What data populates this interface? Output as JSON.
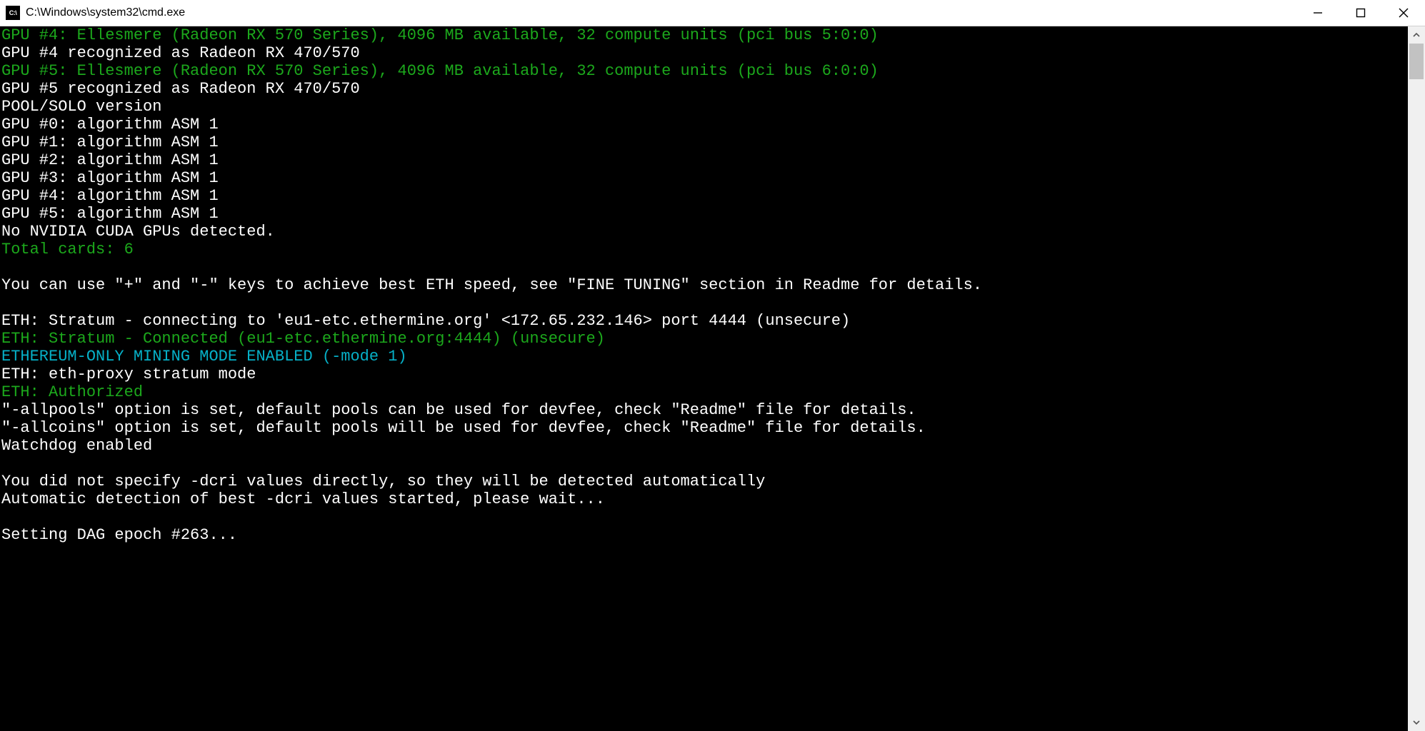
{
  "window": {
    "title": "C:\\Windows\\system32\\cmd.exe",
    "icon_label": "C:\\"
  },
  "lines": [
    {
      "cls": "g",
      "text": "GPU #4: Ellesmere (Radeon RX 570 Series), 4096 MB available, 32 compute units (pci bus 5:0:0)"
    },
    {
      "cls": "",
      "text": "GPU #4 recognized as Radeon RX 470/570"
    },
    {
      "cls": "g",
      "text": "GPU #5: Ellesmere (Radeon RX 570 Series), 4096 MB available, 32 compute units (pci bus 6:0:0)"
    },
    {
      "cls": "",
      "text": "GPU #5 recognized as Radeon RX 470/570"
    },
    {
      "cls": "",
      "text": "POOL/SOLO version"
    },
    {
      "cls": "",
      "text": "GPU #0: algorithm ASM 1"
    },
    {
      "cls": "",
      "text": "GPU #1: algorithm ASM 1"
    },
    {
      "cls": "",
      "text": "GPU #2: algorithm ASM 1"
    },
    {
      "cls": "",
      "text": "GPU #3: algorithm ASM 1"
    },
    {
      "cls": "",
      "text": "GPU #4: algorithm ASM 1"
    },
    {
      "cls": "",
      "text": "GPU #5: algorithm ASM 1"
    },
    {
      "cls": "",
      "text": "No NVIDIA CUDA GPUs detected."
    },
    {
      "cls": "g",
      "text": "Total cards: 6"
    },
    {
      "cls": "",
      "text": ""
    },
    {
      "cls": "",
      "text": "You can use \"+\" and \"-\" keys to achieve best ETH speed, see \"FINE TUNING\" section in Readme for details."
    },
    {
      "cls": "",
      "text": ""
    },
    {
      "cls": "",
      "text": "ETH: Stratum - connecting to 'eu1-etc.ethermine.org' <172.65.232.146> port 4444 (unsecure)"
    },
    {
      "cls": "g",
      "text": "ETH: Stratum - Connected (eu1-etc.ethermine.org:4444) (unsecure)"
    },
    {
      "cls": "c",
      "text": "ETHEREUM-ONLY MINING MODE ENABLED (-mode 1)"
    },
    {
      "cls": "",
      "text": "ETH: eth-proxy stratum mode"
    },
    {
      "cls": "g",
      "text": "ETH: Authorized"
    },
    {
      "cls": "",
      "text": "\"-allpools\" option is set, default pools can be used for devfee, check \"Readme\" file for details."
    },
    {
      "cls": "",
      "text": "\"-allcoins\" option is set, default pools will be used for devfee, check \"Readme\" file for details."
    },
    {
      "cls": "",
      "text": "Watchdog enabled"
    },
    {
      "cls": "",
      "text": ""
    },
    {
      "cls": "",
      "text": "You did not specify -dcri values directly, so they will be detected automatically"
    },
    {
      "cls": "",
      "text": "Automatic detection of best -dcri values started, please wait..."
    },
    {
      "cls": "",
      "text": ""
    },
    {
      "cls": "",
      "text": "Setting DAG epoch #263..."
    }
  ]
}
